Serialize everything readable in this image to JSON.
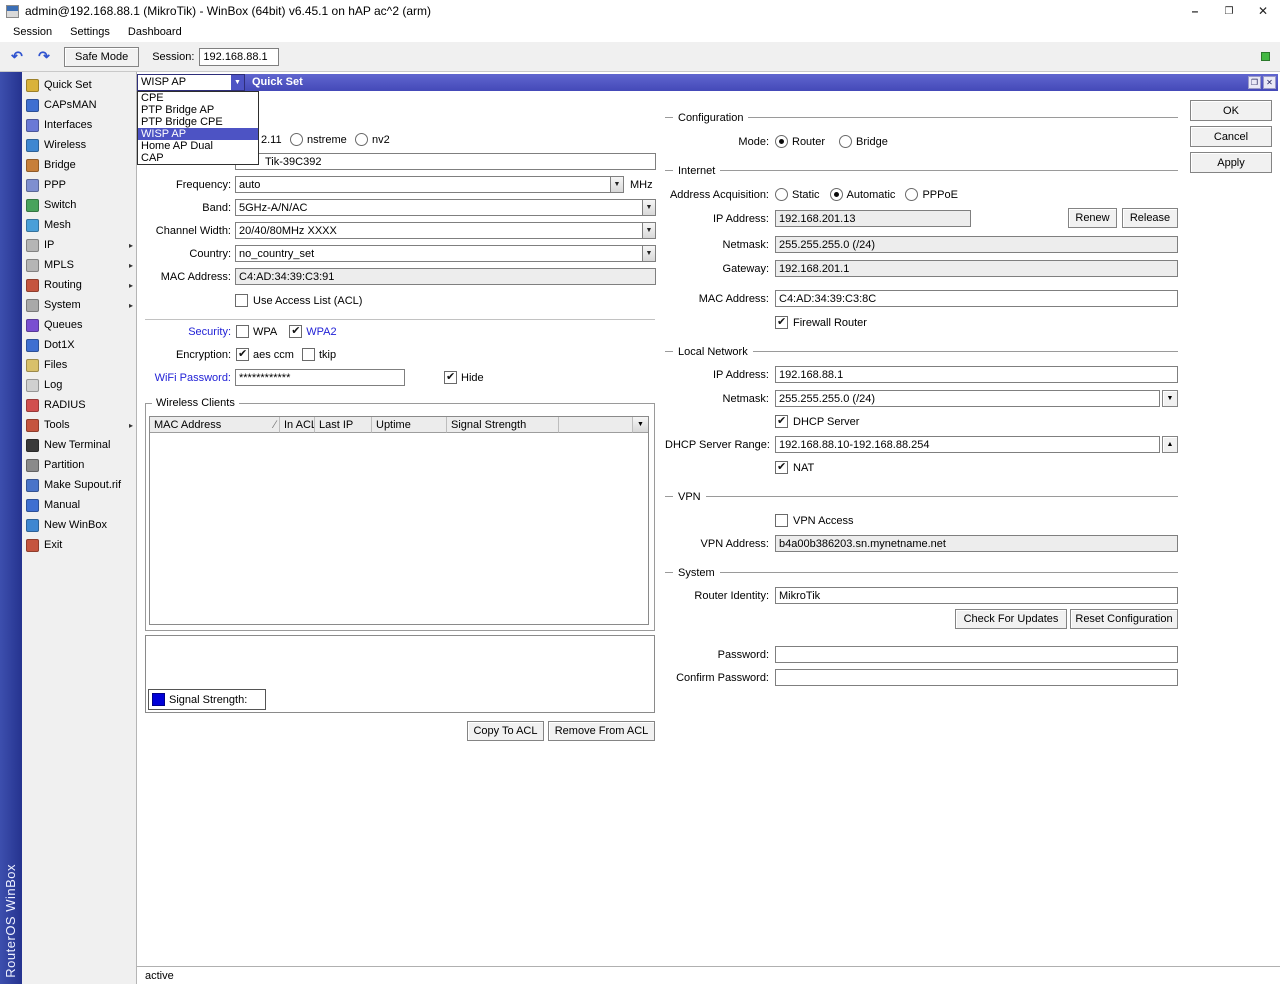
{
  "window": {
    "title": "admin@192.168.88.1 (MikroTik) - WinBox (64bit) v6.45.1 on hAP ac^2 (arm)",
    "menu": [
      "Session",
      "Settings",
      "Dashboard"
    ]
  },
  "toolbar": {
    "safe_mode": "Safe Mode",
    "session_label": "Session:",
    "session_value": "192.168.88.1"
  },
  "brand": "RouterOS WinBox",
  "sidebar": [
    {
      "label": "Quick Set"
    },
    {
      "label": "CAPsMAN"
    },
    {
      "label": "Interfaces"
    },
    {
      "label": "Wireless"
    },
    {
      "label": "Bridge"
    },
    {
      "label": "PPP"
    },
    {
      "label": "Switch"
    },
    {
      "label": "Mesh"
    },
    {
      "label": "IP"
    },
    {
      "label": "MPLS"
    },
    {
      "label": "Routing"
    },
    {
      "label": "System"
    },
    {
      "label": "Queues"
    },
    {
      "label": "Dot1X"
    },
    {
      "label": "Files"
    },
    {
      "label": "Log"
    },
    {
      "label": "RADIUS"
    },
    {
      "label": "Tools"
    },
    {
      "label": "New Terminal"
    },
    {
      "label": "Partition"
    },
    {
      "label": "Make Supout.rif"
    },
    {
      "label": "Manual"
    },
    {
      "label": "New WinBox"
    },
    {
      "label": "Exit"
    }
  ],
  "quickset": {
    "title": "Quick Set",
    "mode_select": {
      "value": "WISP AP",
      "options": [
        "CPE",
        "PTP Bridge AP",
        "PTP Bridge CPE",
        "WISP AP",
        "Home AP Dual",
        "CAP"
      ],
      "selected": "WISP AP"
    },
    "actions": {
      "ok": "OK",
      "cancel": "Cancel",
      "apply": "Apply"
    },
    "wireless": {
      "protocol_fragment": "2.11",
      "protocol_options": [
        "nstreme",
        "nv2"
      ],
      "network_name_value": "Tik-39C392",
      "frequency": {
        "label": "Frequency:",
        "value": "auto",
        "unit": "MHz"
      },
      "band": {
        "label": "Band:",
        "value": "5GHz-A/N/AC"
      },
      "channel_width": {
        "label": "Channel Width:",
        "value": "20/40/80MHz XXXX"
      },
      "country": {
        "label": "Country:",
        "value": "no_country_set"
      },
      "mac_address": {
        "label": "MAC Address:",
        "value": "C4:AD:34:39:C3:91"
      },
      "use_acl": {
        "label": "Use Access List (ACL)",
        "checked": false
      },
      "security": {
        "label": "Security:",
        "wpa": "WPA",
        "wpa2": "WPA2",
        "wpa_checked": false,
        "wpa2_checked": true
      },
      "encryption": {
        "label": "Encryption:",
        "aes": "aes ccm",
        "tkip": "tkip",
        "aes_checked": true,
        "tkip_checked": false
      },
      "wifi_password": {
        "label": "WiFi Password:",
        "value": "************",
        "hide_label": "Hide",
        "hide_checked": true
      },
      "clients": {
        "group_label": "Wireless Clients",
        "columns": [
          "MAC Address",
          "In ACL",
          "Last IP",
          "Uptime",
          "Signal Strength"
        ],
        "rows": []
      },
      "legend_label": "Signal Strength:",
      "copy_button": "Copy To ACL",
      "remove_button": "Remove From ACL"
    },
    "configuration": {
      "group_label": "Configuration",
      "mode_label": "Mode:",
      "mode_options": [
        "Router",
        "Bridge"
      ],
      "mode_selected": "Router"
    },
    "internet": {
      "group_label": "Internet",
      "acquisition_label": "Address Acquisition:",
      "acquisition_options": [
        "Static",
        "Automatic",
        "PPPoE"
      ],
      "acquisition_selected": "Automatic",
      "ip_address": {
        "label": "IP Address:",
        "value": "192.168.201.13"
      },
      "renew_button": "Renew",
      "release_button": "Release",
      "netmask": {
        "label": "Netmask:",
        "value": "255.255.255.0 (/24)"
      },
      "gateway": {
        "label": "Gateway:",
        "value": "192.168.201.1"
      },
      "mac_address": {
        "label": "MAC Address:",
        "value": "C4:AD:34:39:C3:8C"
      },
      "firewall_router": {
        "label": "Firewall Router",
        "checked": true
      }
    },
    "local_network": {
      "group_label": "Local Network",
      "ip_address": {
        "label": "IP Address:",
        "value": "192.168.88.1"
      },
      "netmask": {
        "label": "Netmask:",
        "value": "255.255.255.0 (/24)"
      },
      "dhcp_server": {
        "label": "DHCP Server",
        "checked": true
      },
      "dhcp_range": {
        "label": "DHCP Server Range:",
        "value": "192.168.88.10-192.168.88.254"
      },
      "nat": {
        "label": "NAT",
        "checked": true
      }
    },
    "vpn": {
      "group_label": "VPN",
      "vpn_access": {
        "label": "VPN Access",
        "checked": false
      },
      "vpn_address": {
        "label": "VPN Address:",
        "value": "b4a00b386203.sn.mynetname.net"
      }
    },
    "system": {
      "group_label": "System",
      "router_identity": {
        "label": "Router Identity:",
        "value": "MikroTik"
      },
      "check_updates_button": "Check For Updates",
      "reset_config_button": "Reset Configuration",
      "password_label": "Password:",
      "confirm_password_label": "Confirm Password:"
    },
    "status": "active"
  }
}
